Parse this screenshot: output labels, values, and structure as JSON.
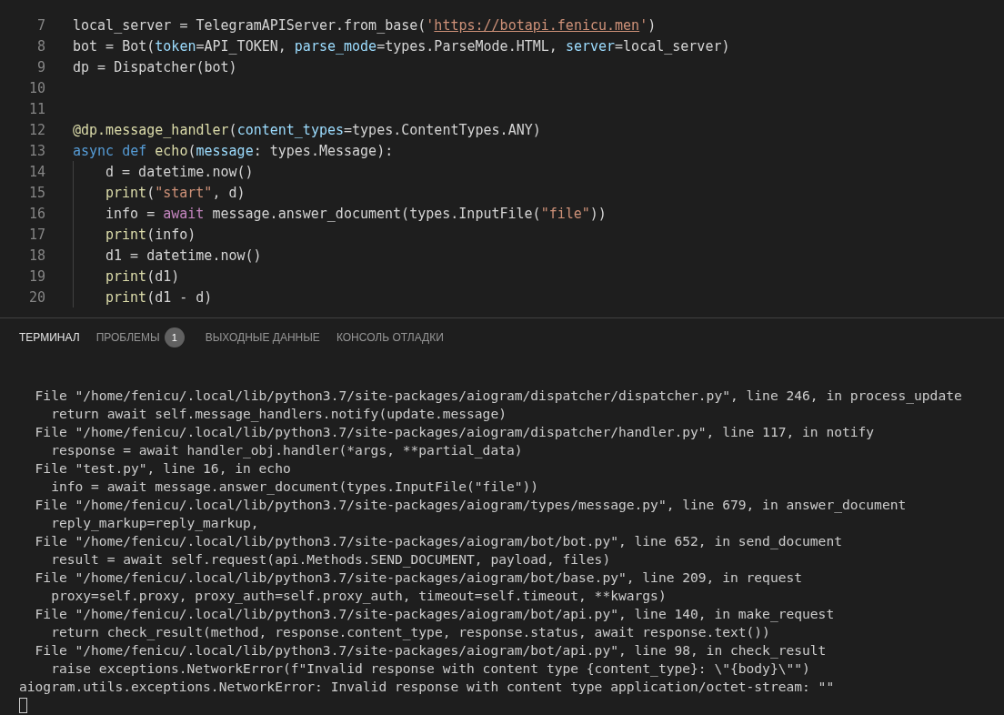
{
  "editor": {
    "lines": [
      {
        "number": "7",
        "tokens": [
          {
            "kind": "plain",
            "text": "local_server = TelegramAPIServer.from_base("
          },
          {
            "kind": "string",
            "text": "'"
          },
          {
            "kind": "link",
            "text": "https://botapi.fenicu.men"
          },
          {
            "kind": "string",
            "text": "'"
          },
          {
            "kind": "plain",
            "text": ")"
          }
        ]
      },
      {
        "number": "8",
        "tokens": [
          {
            "kind": "plain",
            "text": "bot = Bot("
          },
          {
            "kind": "param",
            "text": "token"
          },
          {
            "kind": "plain",
            "text": "=API_TOKEN, "
          },
          {
            "kind": "param",
            "text": "parse_mode"
          },
          {
            "kind": "plain",
            "text": "=types.ParseMode.HTML, "
          },
          {
            "kind": "param",
            "text": "server"
          },
          {
            "kind": "plain",
            "text": "=local_server)"
          }
        ]
      },
      {
        "number": "9",
        "tokens": [
          {
            "kind": "plain",
            "text": "dp = Dispatcher(bot)"
          }
        ]
      },
      {
        "number": "10"
      },
      {
        "number": "11"
      },
      {
        "number": "12",
        "tokens": [
          {
            "kind": "func",
            "text": "@dp.message_handler"
          },
          {
            "kind": "plain",
            "text": "("
          },
          {
            "kind": "param",
            "text": "content_types"
          },
          {
            "kind": "plain",
            "text": "=types.ContentTypes.ANY)"
          }
        ]
      },
      {
        "number": "13",
        "tokens": [
          {
            "kind": "keyword",
            "text": "async def "
          },
          {
            "kind": "func",
            "text": "echo"
          },
          {
            "kind": "plain",
            "text": "("
          },
          {
            "kind": "param",
            "text": "message"
          },
          {
            "kind": "plain",
            "text": ": types.Message):"
          }
        ]
      },
      {
        "number": "14",
        "guide": true,
        "tokens": [
          {
            "kind": "plain",
            "text": "d = datetime.now()"
          }
        ]
      },
      {
        "number": "15",
        "guide": true,
        "tokens": [
          {
            "kind": "func",
            "text": "print"
          },
          {
            "kind": "plain",
            "text": "("
          },
          {
            "kind": "string",
            "text": "\"start\""
          },
          {
            "kind": "plain",
            "text": ", d)"
          }
        ]
      },
      {
        "number": "16",
        "guide": true,
        "tokens": [
          {
            "kind": "plain",
            "text": "info = "
          },
          {
            "kind": "control",
            "text": "await"
          },
          {
            "kind": "plain",
            "text": " message.answer_document(types.InputFile("
          },
          {
            "kind": "string",
            "text": "\"file\""
          },
          {
            "kind": "plain",
            "text": "))"
          }
        ]
      },
      {
        "number": "17",
        "guide": true,
        "tokens": [
          {
            "kind": "func",
            "text": "print"
          },
          {
            "kind": "plain",
            "text": "(info)"
          }
        ]
      },
      {
        "number": "18",
        "guide": true,
        "tokens": [
          {
            "kind": "plain",
            "text": "d1 = datetime.now()"
          }
        ]
      },
      {
        "number": "19",
        "guide": true,
        "tokens": [
          {
            "kind": "func",
            "text": "print"
          },
          {
            "kind": "plain",
            "text": "(d1)"
          }
        ]
      },
      {
        "number": "20",
        "guide": true,
        "tokens": [
          {
            "kind": "func",
            "text": "print"
          },
          {
            "kind": "plain",
            "text": "(d1 - d)"
          }
        ]
      }
    ]
  },
  "panel": {
    "tabs": [
      {
        "label": "ТЕРМИНАЛ",
        "selected": true
      },
      {
        "label": "ПРОБЛЕМЫ",
        "selected": false,
        "badge": "1"
      },
      {
        "label": "ВЫХОДНЫЕ ДАННЫЕ",
        "selected": false
      },
      {
        "label": "КОНСОЛЬ ОТЛАДКИ",
        "selected": false
      }
    ],
    "terminal_lines": [
      "  File \"/home/fenicu/.local/lib/python3.7/site-packages/aiogram/dispatcher/dispatcher.py\", line 246, in process_update",
      "    return await self.message_handlers.notify(update.message)",
      "  File \"/home/fenicu/.local/lib/python3.7/site-packages/aiogram/dispatcher/handler.py\", line 117, in notify",
      "    response = await handler_obj.handler(*args, **partial_data)",
      "  File \"test.py\", line 16, in echo",
      "    info = await message.answer_document(types.InputFile(\"file\"))",
      "  File \"/home/fenicu/.local/lib/python3.7/site-packages/aiogram/types/message.py\", line 679, in answer_document",
      "    reply_markup=reply_markup,",
      "  File \"/home/fenicu/.local/lib/python3.7/site-packages/aiogram/bot/bot.py\", line 652, in send_document",
      "    result = await self.request(api.Methods.SEND_DOCUMENT, payload, files)",
      "  File \"/home/fenicu/.local/lib/python3.7/site-packages/aiogram/bot/base.py\", line 209, in request",
      "    proxy=self.proxy, proxy_auth=self.proxy_auth, timeout=self.timeout, **kwargs)",
      "  File \"/home/fenicu/.local/lib/python3.7/site-packages/aiogram/bot/api.py\", line 140, in make_request",
      "    return check_result(method, response.content_type, response.status, await response.text())",
      "  File \"/home/fenicu/.local/lib/python3.7/site-packages/aiogram/bot/api.py\", line 98, in check_result",
      "    raise exceptions.NetworkError(f\"Invalid response with content type {content_type}: \\\"{body}\\\"\")",
      "aiogram.utils.exceptions.NetworkError: Invalid response with content type application/octet-stream: \"\""
    ]
  }
}
